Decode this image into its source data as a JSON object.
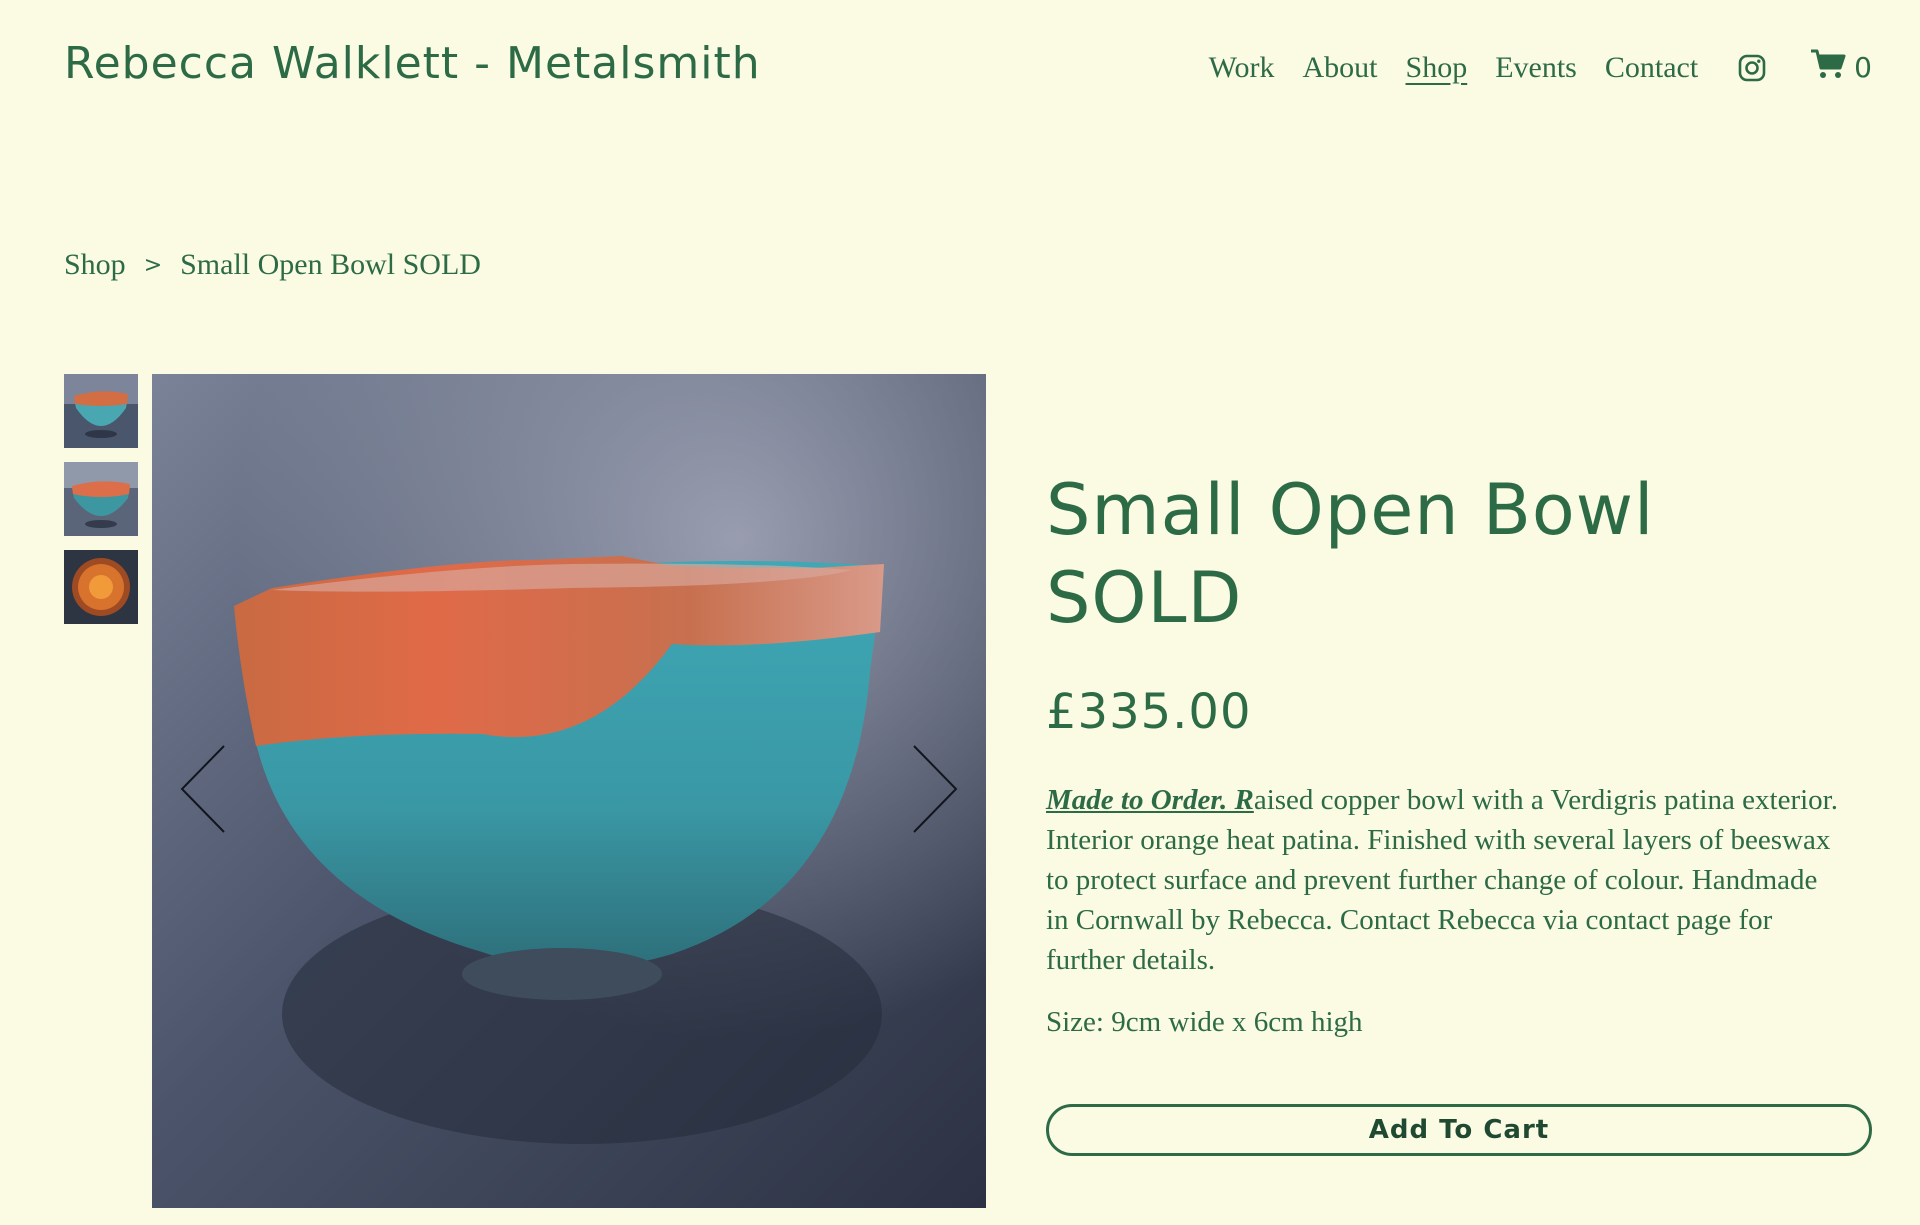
{
  "header": {
    "site_title": "Rebecca Walklett - Metalsmith",
    "nav": [
      "Work",
      "About",
      "Shop",
      "Events",
      "Contact"
    ],
    "cart_count": "0"
  },
  "breadcrumb": {
    "parent": "Shop",
    "separator": ">",
    "current": "Small Open Bowl SOLD"
  },
  "product": {
    "title": "Small Open Bowl SOLD",
    "price": "£335.00",
    "description_lead": "Made to Order. R",
    "description_rest": "aised copper bowl with a Verdigris patina exterior. Interior orange heat patina. Finished with several layers of beeswax to protect surface and prevent further change of colour. Handmade in Cornwall by Rebecca. Contact Rebecca via contact page for further details.",
    "size": "Size: 9cm wide x 6cm high",
    "add_to_cart_label": "Add To Cart"
  },
  "colors": {
    "background": "#fbfae2",
    "accent": "#2d6b46",
    "patina": "#3f9aa3",
    "copper": "#c8603c"
  },
  "icons": {
    "instagram": "instagram-icon",
    "cart": "cart-icon",
    "prev": "chevron-left-icon",
    "next": "chevron-right-icon"
  }
}
